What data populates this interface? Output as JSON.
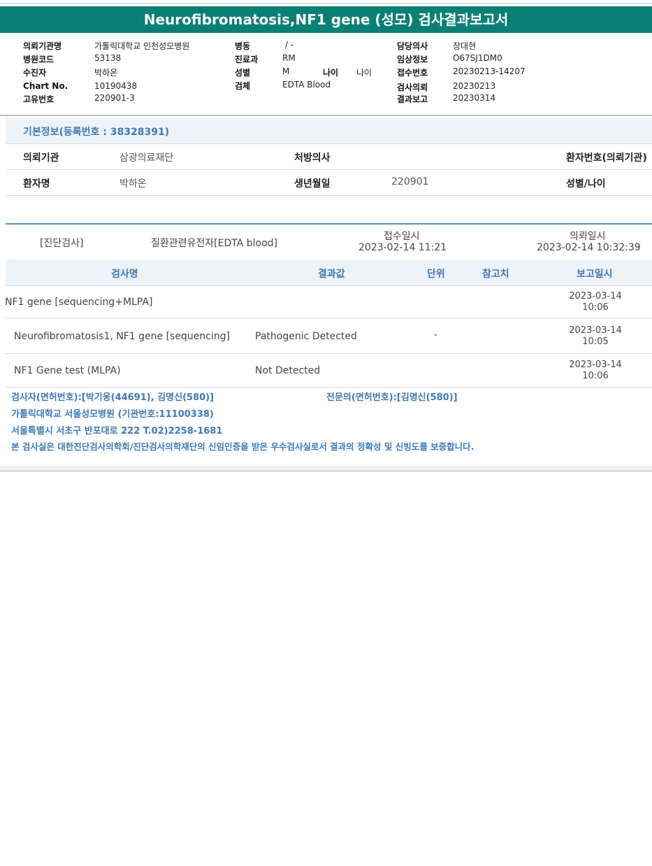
{
  "title": "Neurofibromatosis,NF1 gene (성모) 검사결과보고서",
  "header": {
    "col1": [
      {
        "label": "의뢰기관명",
        "value": "가톨릭대학교 인천성모병원"
      },
      {
        "label": "병원코드",
        "value": "53138"
      },
      {
        "label": "수진자",
        "value": "박하온"
      },
      {
        "label": "Chart No.",
        "value": "10190438"
      },
      {
        "label": "고유번호",
        "value": "220901-3"
      }
    ],
    "col2": [
      {
        "label": "병동",
        "value": "/ -"
      },
      {
        "label": "진료과",
        "value": "RM"
      },
      {
        "label": "성별",
        "value": "M"
      },
      {
        "label": "검체",
        "value": "EDTA Blood"
      }
    ],
    "age_label": "나이",
    "age_value": "나이",
    "col3": [
      {
        "label": "담당의사",
        "value": "장대현"
      },
      {
        "label": "임상정보",
        "value": "O67SJ1DM0"
      },
      {
        "label": "접수번호",
        "value": "20230213-14207"
      },
      {
        "label": "검사의뢰",
        "value": "20230213"
      },
      {
        "label": "결과보고",
        "value": "20230314"
      }
    ]
  },
  "basic_info": {
    "heading": "기본정보(등록번호 : 38328391)",
    "row1": {
      "institution_label": "의뢰기관",
      "institution_value": "삼광의료재단",
      "doctor_label": "처방의사",
      "patient_no_label": "환자번호(의뢰기관)"
    },
    "row2": {
      "name_label": "환자명",
      "name_value": "박하온",
      "birth_label": "생년월일",
      "birth_value": "220901",
      "sex_age_label": "성별/나이"
    }
  },
  "order": {
    "category": "[진단검사]",
    "test_group": "질환관련유전자[EDTA blood]",
    "received_label": "접수일시",
    "received_value": "2023-02-14 11:21",
    "requested_label": "의뢰일시",
    "requested_value": "2023-02-14 10:32:39"
  },
  "results_table": {
    "headers": {
      "name": "검사명",
      "result": "결과값",
      "unit": "단위",
      "reference": "참고치",
      "report_date": "보고일시"
    },
    "rows": [
      {
        "name": "NF1 gene [sequencing+MLPA]",
        "result": "",
        "unit": "",
        "date": "2023-03-14",
        "time": "10:06"
      },
      {
        "name": "Neurofibromatosis1, NF1 gene [sequencing]",
        "result": "Pathogenic Detected",
        "unit": "-",
        "date": "2023-03-14",
        "time": "10:05"
      },
      {
        "name": "NF1 Gene test (MLPA)",
        "result": "Not Detected",
        "unit": "",
        "date": "2023-03-14",
        "time": "10:06"
      }
    ]
  },
  "footer": {
    "examiner": "검사자(면허번호):[박기웅(44691), 김명신(580)]",
    "specialist": "전문의(면허번호):[김명신(580)]",
    "hospital": "가톨릭대학교 서울성모병원 (기관번호:11100338)",
    "address": "서울특별시 서초구 반포대로 222 T.02)2258-1681",
    "certification": "본 검사실은 대한진단검사의학회/진단검사의학재단의 신임인증을 받은 우수검사실로서 결과의 정확성 및 신빙도를 보증합니다."
  },
  "colors": {
    "title_bar": "#0a7f74",
    "accent_blue": "#3d7ab8",
    "header_bg": "#eef3f8"
  }
}
